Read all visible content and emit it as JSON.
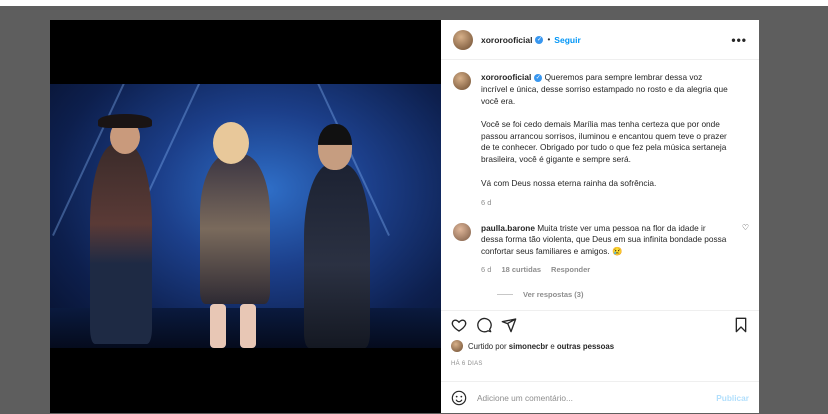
{
  "post": {
    "author": "xororooficial",
    "follow_label": "Seguir",
    "dot": "•",
    "more_label": "•••",
    "caption_paragraphs": [
      "Queremos para sempre lembrar dessa voz incrível e única, desse sorriso estampado no rosto e da alegria que você era.",
      "Você se foi cedo demais Marília mas tenha certeza que por onde passou arrancou sorrisos, iluminou e encantou quem teve o prazer de te conhecer. Obrigado por tudo o que fez pela música sertaneja brasileira, você é gigante e sempre será.",
      "Vá com Deus nossa eterna rainha da sofrência."
    ],
    "caption_age": "6 d"
  },
  "comment": {
    "author": "paulla.barone",
    "text": "Muita triste ver uma pessoa na flor da idade ir dessa forma tão violenta, que Deus em sua infinita bondade possa confortar seus familiares e amigos. 😢",
    "age": "6 d",
    "likes": "18 curtidas",
    "reply_label": "Responder",
    "view_replies": "Ver respostas (3)"
  },
  "likes": {
    "prefix": "Curtido por",
    "user": "simonecbr",
    "conj": "e",
    "others": "outras pessoas"
  },
  "timestamp": "HÁ 6 DIAS",
  "composer": {
    "placeholder": "Adicione um comentário...",
    "publish_label": "Publicar"
  },
  "colors": {
    "accent": "#0095f6",
    "verified": "#3897f0",
    "muted": "#8e8e8e"
  },
  "icons": [
    "heart-icon",
    "comment-icon",
    "share-icon",
    "bookmark-icon",
    "emoji-icon",
    "verified-icon",
    "more-icon"
  ]
}
